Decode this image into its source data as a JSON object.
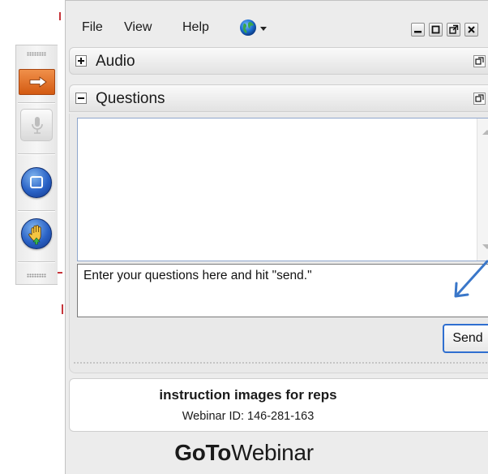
{
  "menubar": {
    "items": [
      "File",
      "View",
      "Help"
    ],
    "language_icon": "globe-icon"
  },
  "window_controls": [
    "minimize-icon",
    "maximize-icon",
    "popout-icon",
    "close-icon"
  ],
  "grabtab": {
    "buttons": [
      "show-hide-panel-icon",
      "microphone-icon",
      "screen-icon",
      "raise-hand-icon"
    ],
    "accent_color": "#e8731f"
  },
  "audio_pane": {
    "toggle": "+",
    "title": "Audio"
  },
  "questions_pane": {
    "toggle": "−",
    "title": "Questions",
    "input_value": "Enter your questions here and hit \"send.\"",
    "send_label": "Send"
  },
  "session": {
    "title": "instruction images for reps",
    "webinar_id": "Webinar ID: 146-281-163"
  },
  "brand": {
    "part1": "GoTo",
    "part2": "Webinar"
  },
  "colors": {
    "annotation_arrow": "#3a77c9",
    "send_border": "#2f6fd0",
    "mark_red": "#c7353b"
  }
}
